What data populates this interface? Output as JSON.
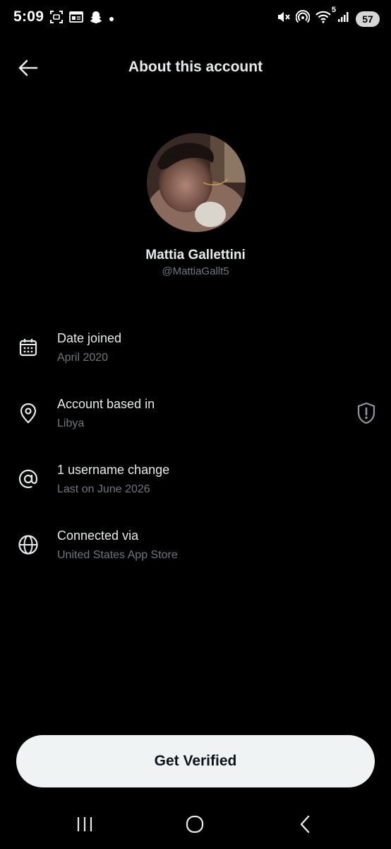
{
  "status_bar": {
    "time": "5:09",
    "battery": "57",
    "network": "5"
  },
  "header": {
    "title": "About this account"
  },
  "profile": {
    "name": "Mattia Gallettini",
    "handle": "@MattiaGallt5"
  },
  "info_rows": [
    {
      "title": "Date joined",
      "subtitle": "April 2020",
      "icon": "calendar-icon"
    },
    {
      "title": "Account based in",
      "subtitle": "Libya",
      "icon": "location-pin-icon"
    },
    {
      "title": "1 username change",
      "subtitle": "Last on June 2026",
      "icon": "at-sign-icon"
    },
    {
      "title": "Connected via",
      "subtitle": "United States App Store",
      "icon": "globe-icon"
    }
  ],
  "verify_button": {
    "label": "Get Verified"
  },
  "colors": {
    "background": "#000000",
    "primary_text": "#e7e9ea",
    "secondary_text": "#71767b",
    "button_bg": "#eff3f4",
    "button_text": "#0f1419"
  }
}
